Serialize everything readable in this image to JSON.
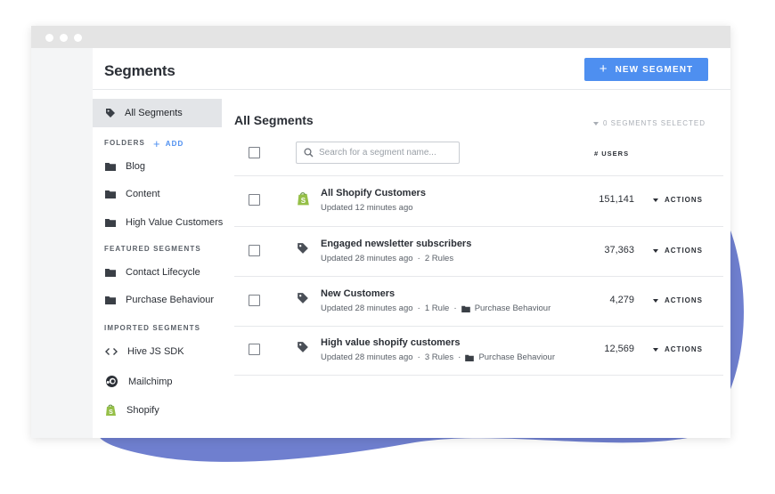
{
  "header": {
    "title": "Segments",
    "new_button": "NEW SEGMENT"
  },
  "sidebar": {
    "all_label": "All Segments",
    "folders_label": "FOLDERS",
    "add_label": "ADD",
    "folders": [
      "Blog",
      "Content",
      "High Value Customers"
    ],
    "featured_label": "FEATURED SEGMENTS",
    "featured": [
      "Contact Lifecycle",
      "Purchase Behaviour"
    ],
    "imported_label": "IMPORTED SEGMENTS",
    "imported": [
      {
        "label": "Hive JS SDK",
        "icon": "code-icon"
      },
      {
        "label": "Mailchimp",
        "icon": "mailchimp-icon"
      },
      {
        "label": "Shopify",
        "icon": "shopify-icon"
      }
    ]
  },
  "main": {
    "title": "All Segments",
    "selected_text": "0 SEGMENTS SELECTED",
    "search_placeholder": "Search for a segment name...",
    "users_header": "# USERS",
    "actions_label": "ACTIONS",
    "rows": [
      {
        "name": "All Shopify Customers",
        "updated": "Updated 12 minutes ago",
        "rules": "",
        "folder": "",
        "count": "151,141",
        "icon": "shopify-icon"
      },
      {
        "name": "Engaged newsletter subscribers",
        "updated": "Updated 28 minutes ago",
        "rules": "2 Rules",
        "folder": "",
        "count": "37,363",
        "icon": "tag-icon"
      },
      {
        "name": "New Customers",
        "updated": "Updated 28 minutes ago",
        "rules": "1 Rule",
        "folder": "Purchase Behaviour",
        "count": "4,279",
        "icon": "tag-icon"
      },
      {
        "name": "High value shopify customers",
        "updated": "Updated 28 minutes ago",
        "rules": "3 Rules",
        "folder": "Purchase Behaviour",
        "count": "12,569",
        "icon": "tag-icon"
      }
    ]
  },
  "colors": {
    "accent": "#4e8ff0",
    "blob": "#6f7fcf",
    "shopify_green": "#95bf47"
  }
}
